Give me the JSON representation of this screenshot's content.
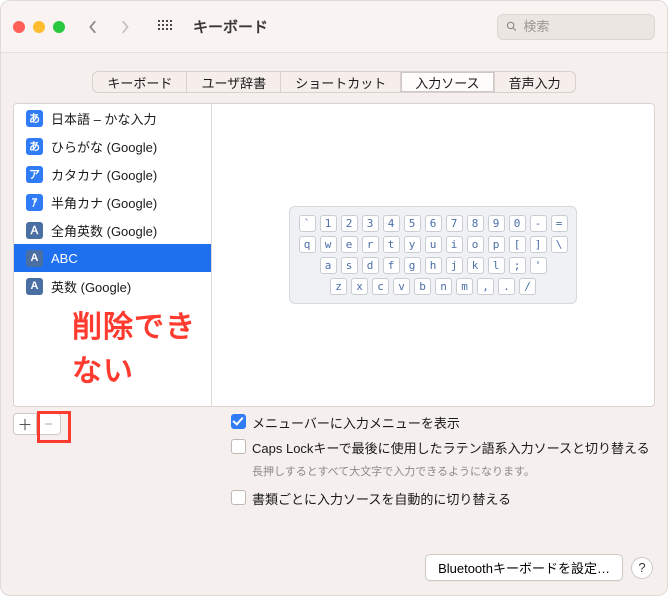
{
  "titlebar": {
    "title": "キーボード",
    "search_placeholder": "検索"
  },
  "tabs": {
    "items": [
      {
        "label": "キーボード"
      },
      {
        "label": "ユーザ辞書"
      },
      {
        "label": "ショートカット"
      },
      {
        "label": "入力ソース"
      },
      {
        "label": "音声入力"
      }
    ],
    "active_index": 3
  },
  "sources": {
    "items": [
      {
        "icon": "あ",
        "icon_type": "a-type",
        "label": "日本語 – かな入力"
      },
      {
        "icon": "あ",
        "icon_type": "a-type",
        "label": "ひらがな (Google)"
      },
      {
        "icon": "ア",
        "icon_type": "ka-type",
        "label": "カタカナ (Google)"
      },
      {
        "icon": "ｱ",
        "icon_type": "ka-type",
        "label": "半角カナ (Google)"
      },
      {
        "icon": "Ａ",
        "icon_type": "abc-type",
        "label": "全角英数 (Google)"
      },
      {
        "icon": "A",
        "icon_type": "abc-type",
        "label": "ABC"
      },
      {
        "icon": "A",
        "icon_type": "abc-type",
        "label": "英数 (Google)"
      }
    ],
    "selected_index": 5
  },
  "keyboard_preview": {
    "rows": [
      [
        "`",
        "1",
        "2",
        "3",
        "4",
        "5",
        "6",
        "7",
        "8",
        "9",
        "0",
        "-",
        "="
      ],
      [
        "q",
        "w",
        "e",
        "r",
        "t",
        "y",
        "u",
        "i",
        "o",
        "p",
        "[",
        "]",
        "\\"
      ],
      [
        "a",
        "s",
        "d",
        "f",
        "g",
        "h",
        "j",
        "k",
        "l",
        ";",
        "'"
      ],
      [
        "z",
        "x",
        "c",
        "v",
        "b",
        "n",
        "m",
        ",",
        ".",
        "/"
      ]
    ]
  },
  "annotation": "削除できない",
  "add_remove": {
    "add": "＋",
    "remove": "−"
  },
  "options": {
    "show_menu": {
      "checked": true,
      "label": "メニューバーに入力メニューを表示"
    },
    "caps_lock": {
      "checked": false,
      "label": "Caps Lockキーで最後に使用したラテン語系入力ソースと切り替える",
      "hint": "長押しするとすべて大文字で入力できるようになります。"
    },
    "per_doc": {
      "checked": false,
      "label": "書類ごとに入力ソースを自動的に切り替える"
    }
  },
  "bottom": {
    "bt_button": "Bluetoothキーボードを設定…",
    "help": "?"
  }
}
